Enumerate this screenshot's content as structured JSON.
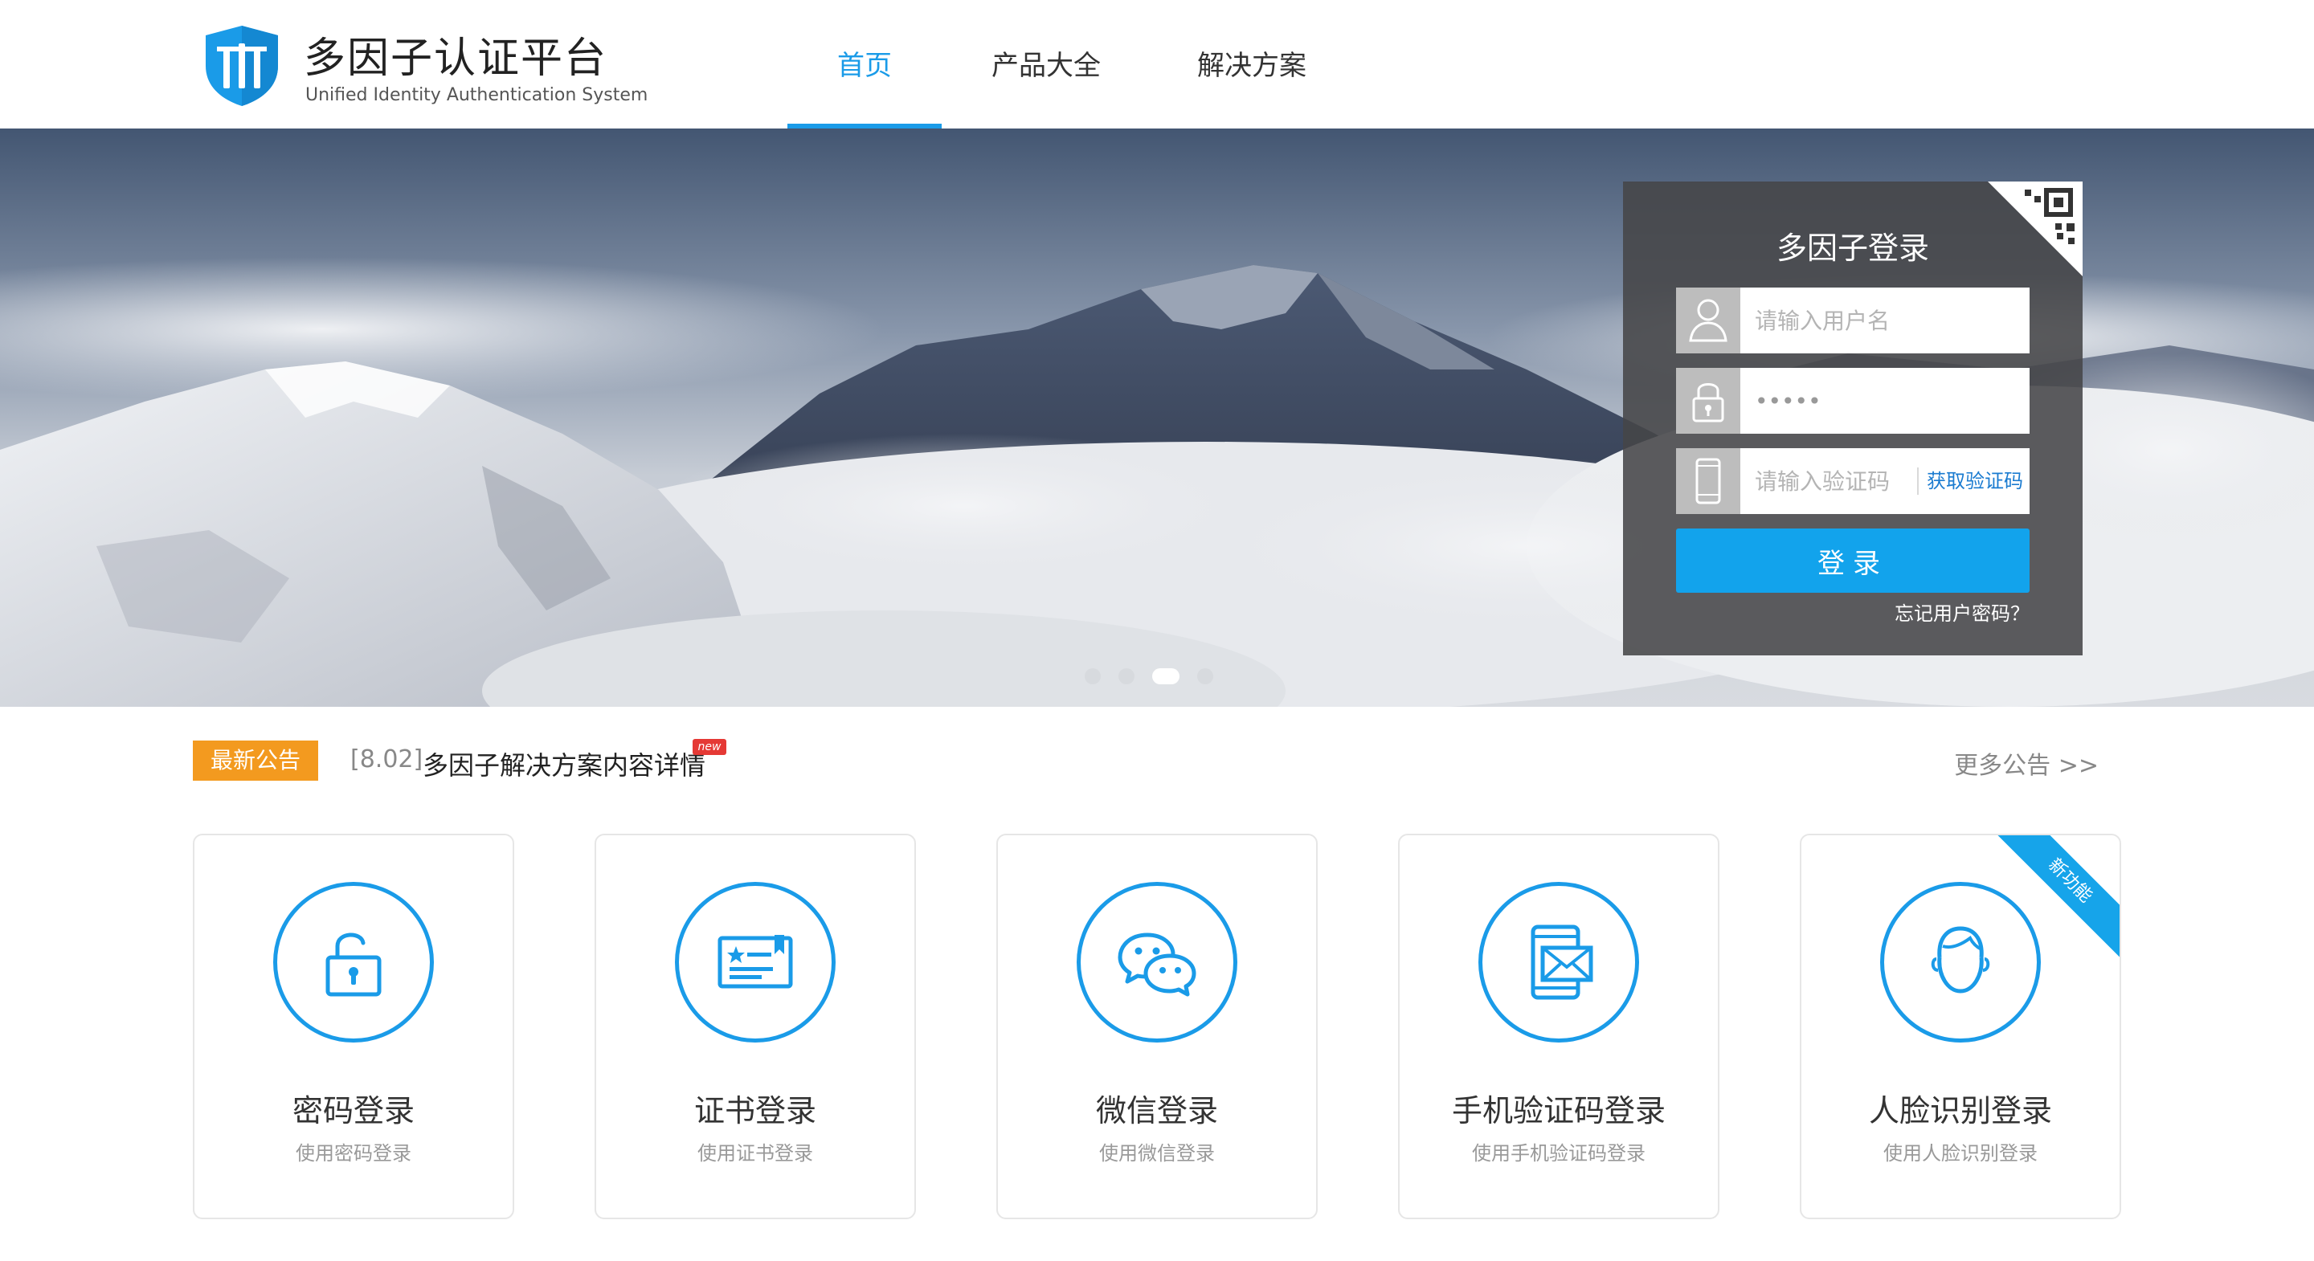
{
  "header": {
    "brand_title": "多因子认证平台",
    "brand_subtitle": "Unified Identity Authentication System",
    "nav": [
      "首页",
      "产品大全",
      "解决方案"
    ],
    "active_nav": "首页",
    "accent_color": "#1a9be8"
  },
  "banner": {
    "slide_count": 4,
    "active_slide": 3
  },
  "login": {
    "title": "多因子登录",
    "username_placeholder": "请输入用户名",
    "password_value": "•••••",
    "code_placeholder": "请输入验证码",
    "get_code_label": "获取验证码",
    "submit_label": "登录",
    "forgot_label": "忘记用户密码？",
    "button_color": "#12a3ec"
  },
  "notice": {
    "badge": "最新公告",
    "date": "[8.02]",
    "text": "多因子解决方案内容详情",
    "new_tag": "new",
    "more": "更多公告 >>",
    "badge_color": "#f39a1f"
  },
  "cards": [
    {
      "title": "密码登录",
      "subtitle": "使用密码登录",
      "icon": "lock-icon"
    },
    {
      "title": "证书登录",
      "subtitle": "使用证书登录",
      "icon": "certificate-icon"
    },
    {
      "title": "微信登录",
      "subtitle": "使用微信登录",
      "icon": "wechat-icon"
    },
    {
      "title": "手机验证码登录",
      "subtitle": "使用手机验证码登录",
      "icon": "phone-message-icon"
    },
    {
      "title": "人脸识别登录",
      "subtitle": "使用人脸识别登录",
      "icon": "face-icon",
      "ribbon": "新功能"
    }
  ]
}
